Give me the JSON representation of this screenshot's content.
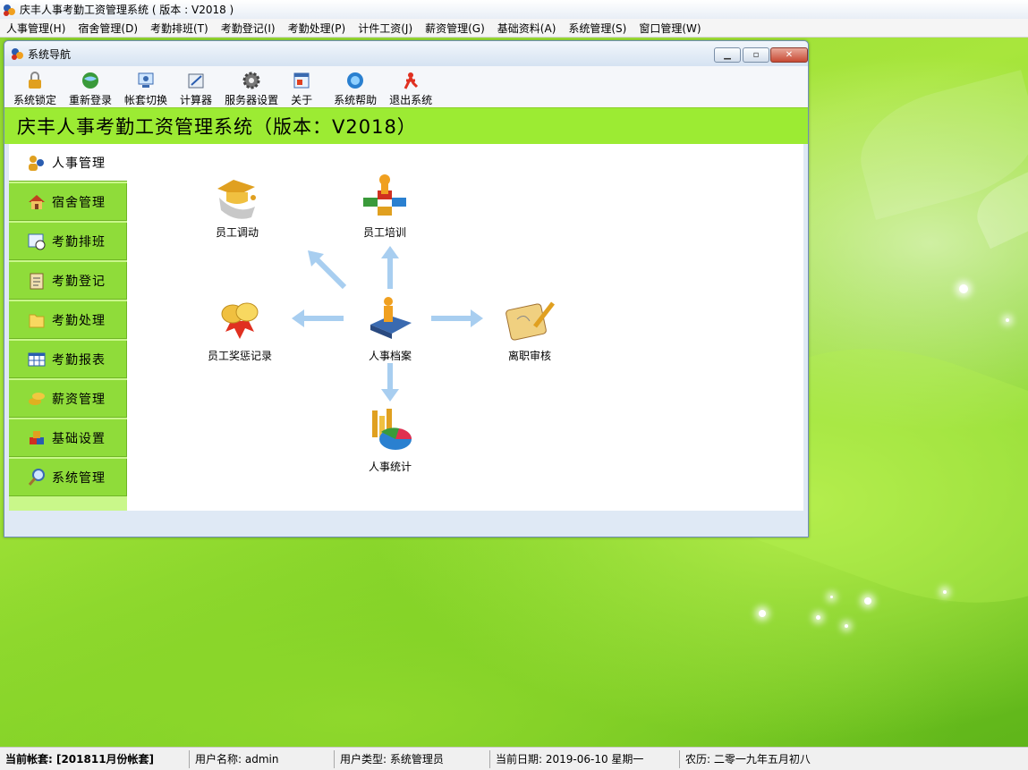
{
  "app": {
    "title": "庆丰人事考勤工资管理系统 ( 版本 : V2018 )"
  },
  "menubar": [
    "人事管理(H)",
    "宿舍管理(D)",
    "考勤排班(T)",
    "考勤登记(I)",
    "考勤处理(P)",
    "计件工资(J)",
    "薪资管理(G)",
    "基础资料(A)",
    "系统管理(S)",
    "窗口管理(W)"
  ],
  "nav_window": {
    "title": "系统导航",
    "toolbar": [
      "系统锁定",
      "重新登录",
      "帐套切换",
      "计算器",
      "服务器设置",
      "关于",
      "系统帮助",
      "退出系统"
    ],
    "banner": "庆丰人事考勤工资管理系统（版本：V2018）",
    "sidebar": [
      "人事管理",
      "宿舍管理",
      "考勤排班",
      "考勤登记",
      "考勤处理",
      "考勤报表",
      "薪资管理",
      "基础设置",
      "系统管理"
    ],
    "functions": {
      "transfer": "员工调动",
      "training": "员工培训",
      "rewards": "员工奖惩记录",
      "archive": "人事档案",
      "resign": "离职审核",
      "stats": "人事统计"
    }
  },
  "statusbar": {
    "account": "当前帐套: [201811月份帐套]",
    "username": "用户名称: admin",
    "usertype": "用户类型: 系统管理员",
    "date": "当前日期: 2019-06-10  星期一",
    "lunar": "农历: 二零一九年五月初八"
  },
  "colors": {
    "banner": "#9ceb33",
    "sidebar_tab": "#8fdc3a",
    "sidebar_bg": "#c9f78a",
    "desktop": "#8ed62e"
  },
  "icons": {
    "app": "app-logo-icon",
    "toolbar": [
      "lock-icon",
      "relogin-globe-icon",
      "account-switch-icon",
      "calculator-icon",
      "server-gear-icon",
      "about-icon",
      "help-globe-icon",
      "exit-icon"
    ]
  }
}
